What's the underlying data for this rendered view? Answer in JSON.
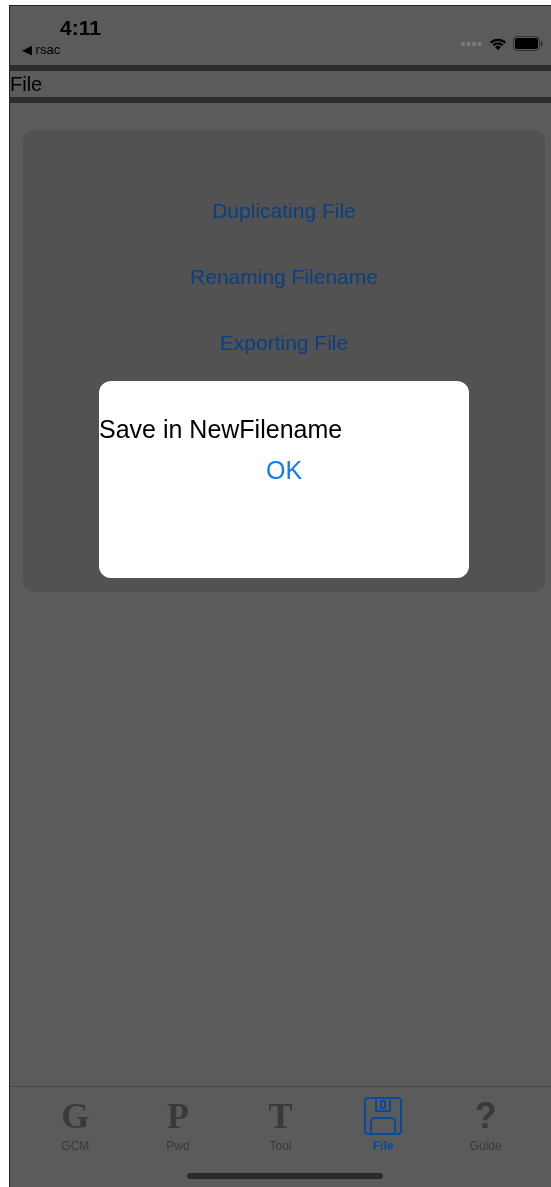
{
  "status_bar": {
    "time": "4:11",
    "back_label": "◀ rsac"
  },
  "header": {
    "title": "File"
  },
  "menu": [
    {
      "label": "Duplicating File"
    },
    {
      "label": "Renaming Filename"
    },
    {
      "label": "Exporting File"
    }
  ],
  "alert": {
    "message": "Save in NewFilename",
    "button": "OK"
  },
  "tabs": [
    {
      "kind": "glyph",
      "icon": "G",
      "label": "GCM",
      "selected": false
    },
    {
      "kind": "glyph",
      "icon": "P",
      "label": "Pwd",
      "selected": false
    },
    {
      "kind": "glyph",
      "icon": "T",
      "label": "Tool",
      "selected": false
    },
    {
      "kind": "floppy",
      "label": "File",
      "selected": true
    },
    {
      "kind": "glyph",
      "icon": "?",
      "label": "Guide",
      "selected": false
    }
  ]
}
